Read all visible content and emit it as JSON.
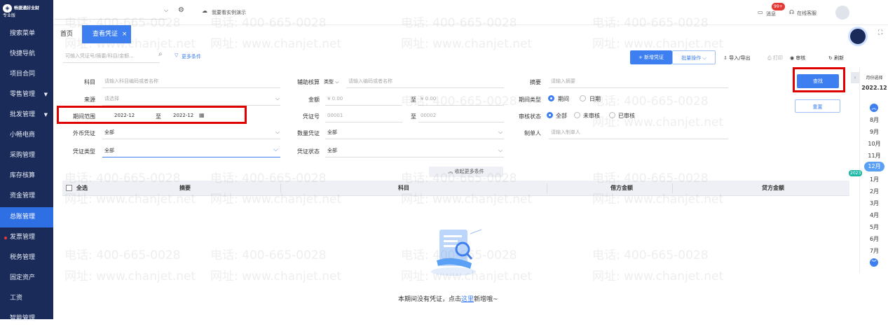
{
  "brand": {
    "name": "畅捷通好业财",
    "edition": "专业版"
  },
  "sidebar": {
    "items": [
      {
        "label": "搜索菜单"
      },
      {
        "label": "快捷导航"
      },
      {
        "label": "项目合同"
      },
      {
        "label": "零售管理",
        "arrow": "▼"
      },
      {
        "label": "批发管理",
        "arrow": "▼"
      },
      {
        "label": "小畅电商"
      },
      {
        "label": "采购管理"
      },
      {
        "label": "库存核算"
      },
      {
        "label": "资金管理"
      },
      {
        "label": "总账管理"
      },
      {
        "label": "发票管理"
      },
      {
        "label": "税务管理"
      },
      {
        "label": "固定资产"
      },
      {
        "label": "工资"
      },
      {
        "label": "智能管理"
      }
    ]
  },
  "topbar": {
    "demo_link": "我要看实例演示",
    "messages_label": "消息",
    "messages_badge": "99+",
    "service_label": "在线客服"
  },
  "tabs": {
    "home": "首页",
    "active": "查看凭证",
    "close": "×"
  },
  "filterbar": {
    "search_placeholder": "可输入凭证号/摘要/科目/金额...",
    "more_conditions": "更多条件",
    "new_voucher": "+ 新增凭证",
    "batch_ops": "批量操作",
    "import_export": "导入/导出",
    "print": "打印",
    "audit": "审核",
    "refresh": "刷新"
  },
  "form": {
    "subject_label": "科目",
    "subject_placeholder": "请输入科目编码或者名称",
    "aux_label": "辅助核算",
    "aux_type": "类型",
    "aux_placeholder": "请输入编码或者名称",
    "summary_label": "摘要",
    "summary_placeholder": "请输入摘要",
    "source_label": "来源",
    "source_placeholder": "请选择",
    "amount_label": "金额",
    "amount_from": "¥ 0.00",
    "amount_to_label": "至",
    "amount_to": "¥ 0.00",
    "period_type_label": "期间类型",
    "period_opt_1": "期间",
    "period_opt_2": "日期",
    "period_range_label": "期间范围",
    "period_from": "2022-12",
    "period_to_label": "至",
    "period_to": "2022-12",
    "voucher_no_label": "凭证号",
    "voucher_no_from": "00001",
    "voucher_no_to_label": "至",
    "voucher_no_to": "00002",
    "audit_status_label": "审核状态",
    "audit_opt_all": "全部",
    "audit_opt_unaudited": "未审核",
    "audit_opt_audited": "已审核",
    "currency_label": "外币凭证",
    "currency_value": "全部",
    "qty_label": "数量凭证",
    "qty_value": "全部",
    "maker_label": "制单人",
    "maker_placeholder": "请输入制单人",
    "vtype_label": "凭证类型",
    "vtype_value": "全部",
    "vstatus_label": "凭证状态",
    "vstatus_value": "全部",
    "search_button": "查找",
    "reset_button": "重置",
    "collapse": "收起更多条件"
  },
  "table": {
    "select_all": "全选",
    "col_summary": "摘要",
    "col_subject": "科目",
    "col_debit": "借方金额",
    "col_credit": "贷方金额"
  },
  "empty": {
    "prefix": "本期间没有凭证，点击",
    "link": "这里",
    "suffix": "新增哦~"
  },
  "month_panel": {
    "title": "月份选择",
    "current": "2022.12",
    "year_badge": "2023",
    "months": [
      "8月",
      "9月",
      "10月",
      "11月",
      "12月",
      "1月",
      "2月",
      "3月",
      "4月",
      "5月",
      "6月",
      "7月"
    ],
    "selected": "12月"
  },
  "watermark": {
    "phone": "电话: 400-665-0028",
    "site": "网址: www.chanjet.net"
  },
  "colors": {
    "sidebar": "#1a2b59",
    "accent": "#2f6fe4",
    "highlight": "#e00000"
  }
}
